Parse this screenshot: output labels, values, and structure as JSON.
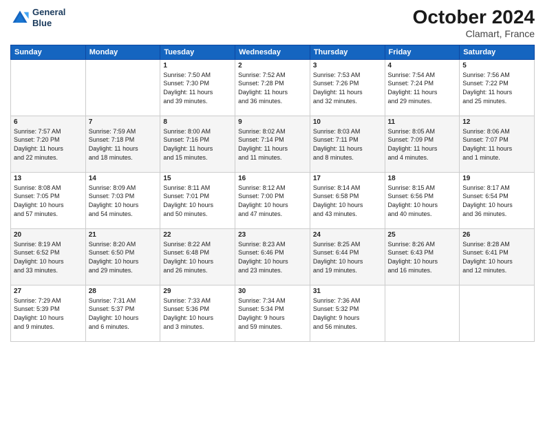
{
  "header": {
    "logo_line1": "General",
    "logo_line2": "Blue",
    "month": "October 2024",
    "location": "Clamart, France"
  },
  "days_of_week": [
    "Sunday",
    "Monday",
    "Tuesday",
    "Wednesday",
    "Thursday",
    "Friday",
    "Saturday"
  ],
  "weeks": [
    [
      {
        "day": "",
        "info": ""
      },
      {
        "day": "",
        "info": ""
      },
      {
        "day": "1",
        "info": "Sunrise: 7:50 AM\nSunset: 7:30 PM\nDaylight: 11 hours\nand 39 minutes."
      },
      {
        "day": "2",
        "info": "Sunrise: 7:52 AM\nSunset: 7:28 PM\nDaylight: 11 hours\nand 36 minutes."
      },
      {
        "day": "3",
        "info": "Sunrise: 7:53 AM\nSunset: 7:26 PM\nDaylight: 11 hours\nand 32 minutes."
      },
      {
        "day": "4",
        "info": "Sunrise: 7:54 AM\nSunset: 7:24 PM\nDaylight: 11 hours\nand 29 minutes."
      },
      {
        "day": "5",
        "info": "Sunrise: 7:56 AM\nSunset: 7:22 PM\nDaylight: 11 hours\nand 25 minutes."
      }
    ],
    [
      {
        "day": "6",
        "info": "Sunrise: 7:57 AM\nSunset: 7:20 PM\nDaylight: 11 hours\nand 22 minutes."
      },
      {
        "day": "7",
        "info": "Sunrise: 7:59 AM\nSunset: 7:18 PM\nDaylight: 11 hours\nand 18 minutes."
      },
      {
        "day": "8",
        "info": "Sunrise: 8:00 AM\nSunset: 7:16 PM\nDaylight: 11 hours\nand 15 minutes."
      },
      {
        "day": "9",
        "info": "Sunrise: 8:02 AM\nSunset: 7:14 PM\nDaylight: 11 hours\nand 11 minutes."
      },
      {
        "day": "10",
        "info": "Sunrise: 8:03 AM\nSunset: 7:11 PM\nDaylight: 11 hours\nand 8 minutes."
      },
      {
        "day": "11",
        "info": "Sunrise: 8:05 AM\nSunset: 7:09 PM\nDaylight: 11 hours\nand 4 minutes."
      },
      {
        "day": "12",
        "info": "Sunrise: 8:06 AM\nSunset: 7:07 PM\nDaylight: 11 hours\nand 1 minute."
      }
    ],
    [
      {
        "day": "13",
        "info": "Sunrise: 8:08 AM\nSunset: 7:05 PM\nDaylight: 10 hours\nand 57 minutes."
      },
      {
        "day": "14",
        "info": "Sunrise: 8:09 AM\nSunset: 7:03 PM\nDaylight: 10 hours\nand 54 minutes."
      },
      {
        "day": "15",
        "info": "Sunrise: 8:11 AM\nSunset: 7:01 PM\nDaylight: 10 hours\nand 50 minutes."
      },
      {
        "day": "16",
        "info": "Sunrise: 8:12 AM\nSunset: 7:00 PM\nDaylight: 10 hours\nand 47 minutes."
      },
      {
        "day": "17",
        "info": "Sunrise: 8:14 AM\nSunset: 6:58 PM\nDaylight: 10 hours\nand 43 minutes."
      },
      {
        "day": "18",
        "info": "Sunrise: 8:15 AM\nSunset: 6:56 PM\nDaylight: 10 hours\nand 40 minutes."
      },
      {
        "day": "19",
        "info": "Sunrise: 8:17 AM\nSunset: 6:54 PM\nDaylight: 10 hours\nand 36 minutes."
      }
    ],
    [
      {
        "day": "20",
        "info": "Sunrise: 8:19 AM\nSunset: 6:52 PM\nDaylight: 10 hours\nand 33 minutes."
      },
      {
        "day": "21",
        "info": "Sunrise: 8:20 AM\nSunset: 6:50 PM\nDaylight: 10 hours\nand 29 minutes."
      },
      {
        "day": "22",
        "info": "Sunrise: 8:22 AM\nSunset: 6:48 PM\nDaylight: 10 hours\nand 26 minutes."
      },
      {
        "day": "23",
        "info": "Sunrise: 8:23 AM\nSunset: 6:46 PM\nDaylight: 10 hours\nand 23 minutes."
      },
      {
        "day": "24",
        "info": "Sunrise: 8:25 AM\nSunset: 6:44 PM\nDaylight: 10 hours\nand 19 minutes."
      },
      {
        "day": "25",
        "info": "Sunrise: 8:26 AM\nSunset: 6:43 PM\nDaylight: 10 hours\nand 16 minutes."
      },
      {
        "day": "26",
        "info": "Sunrise: 8:28 AM\nSunset: 6:41 PM\nDaylight: 10 hours\nand 12 minutes."
      }
    ],
    [
      {
        "day": "27",
        "info": "Sunrise: 7:29 AM\nSunset: 5:39 PM\nDaylight: 10 hours\nand 9 minutes."
      },
      {
        "day": "28",
        "info": "Sunrise: 7:31 AM\nSunset: 5:37 PM\nDaylight: 10 hours\nand 6 minutes."
      },
      {
        "day": "29",
        "info": "Sunrise: 7:33 AM\nSunset: 5:36 PM\nDaylight: 10 hours\nand 3 minutes."
      },
      {
        "day": "30",
        "info": "Sunrise: 7:34 AM\nSunset: 5:34 PM\nDaylight: 9 hours\nand 59 minutes."
      },
      {
        "day": "31",
        "info": "Sunrise: 7:36 AM\nSunset: 5:32 PM\nDaylight: 9 hours\nand 56 minutes."
      },
      {
        "day": "",
        "info": ""
      },
      {
        "day": "",
        "info": ""
      }
    ]
  ]
}
